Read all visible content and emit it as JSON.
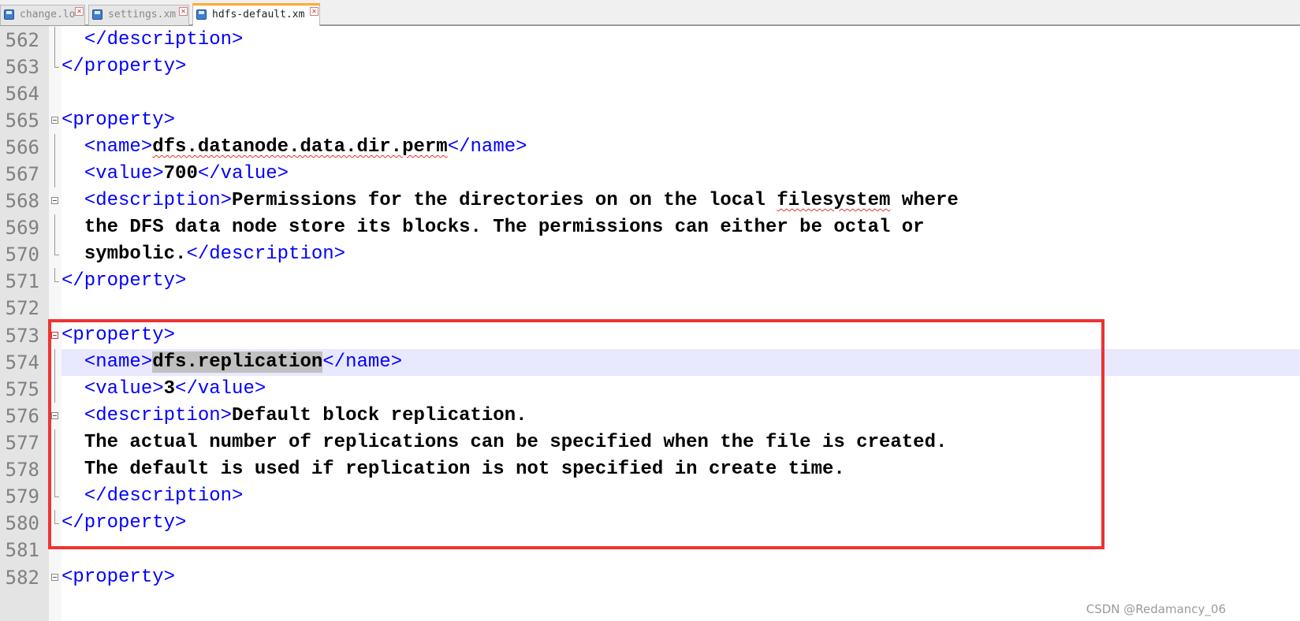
{
  "tabs": [
    {
      "label": "change.lo",
      "active": false
    },
    {
      "label": "settings.xm",
      "active": false
    },
    {
      "label": "hdfs-default.xm",
      "active": true
    }
  ],
  "lines": {
    "l562": {
      "num": "562",
      "tag": "</description>"
    },
    "l563": {
      "num": "563",
      "tag": "</property>"
    },
    "l564": {
      "num": "564"
    },
    "l565": {
      "num": "565",
      "tag": "<property>"
    },
    "l566": {
      "num": "566",
      "open": "<name>",
      "text": "dfs.datanode.data.dir.perm",
      "close": "</name>"
    },
    "l567": {
      "num": "567",
      "open": "<value>",
      "text": "700",
      "close": "</value>"
    },
    "l568": {
      "num": "568",
      "open": "<description>",
      "text_a": "Permissions for the directories on on the local ",
      "text_b": "filesystem",
      "text_c": " where"
    },
    "l569": {
      "num": "569",
      "text": "the DFS data node store its blocks. The permissions can either be octal or"
    },
    "l570": {
      "num": "570",
      "text": "symbolic.",
      "close": "</description>"
    },
    "l571": {
      "num": "571",
      "tag": "</property>"
    },
    "l572": {
      "num": "572"
    },
    "l573": {
      "num": "573",
      "tag": "<property>"
    },
    "l574": {
      "num": "574",
      "open": "<name>",
      "text": "dfs.replication",
      "close": "</name>"
    },
    "l575": {
      "num": "575",
      "open": "<value>",
      "text": "3",
      "close": "</value>"
    },
    "l576": {
      "num": "576",
      "open": "<description>",
      "text": "Default block replication."
    },
    "l577": {
      "num": "577",
      "text": "The actual number of replications can be specified when the file is created."
    },
    "l578": {
      "num": "578",
      "text": "The default is used if replication is not specified in create time."
    },
    "l579": {
      "num": "579",
      "tag": "</description>"
    },
    "l580": {
      "num": "580",
      "tag": "</property>"
    },
    "l581": {
      "num": "581"
    },
    "l582": {
      "num": "582",
      "tag": "<property>"
    }
  },
  "watermark": "CSDN @Redamancy_06",
  "colors": {
    "tag": "#0000ff",
    "highlight_box": "#ee3333",
    "current_line": "#e8e8ff",
    "active_tab_accent": "#ffaa33"
  }
}
